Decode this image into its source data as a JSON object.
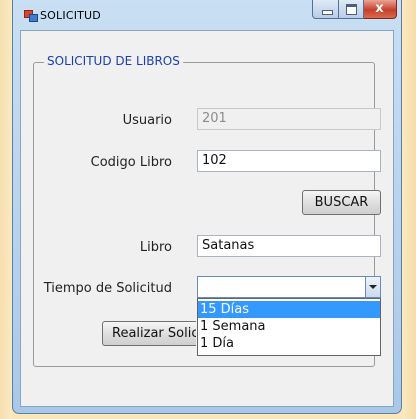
{
  "window": {
    "title": "SOLICITUD",
    "close_glyph": "x",
    "icon": "form-app-icon"
  },
  "group": {
    "title": "SOLICITUD DE LIBROS"
  },
  "form": {
    "usuario_label": "Usuario",
    "usuario_value": "201",
    "codigo_label": "Codigo Libro",
    "codigo_value": "102",
    "buscar_label": "BUSCAR",
    "libro_label": "Libro",
    "libro_value": "Satanas",
    "tiempo_label": "Tiempo de Solicitud",
    "tiempo_value": "",
    "realizar_label": "Realizar Solicitud"
  },
  "dropdown": {
    "options": [
      "15 Días",
      "1 Semana",
      "1 Día"
    ],
    "highlighted": "15 Días"
  },
  "colors": {
    "group_title": "#1a3fb0",
    "selection": "#3399ff"
  }
}
